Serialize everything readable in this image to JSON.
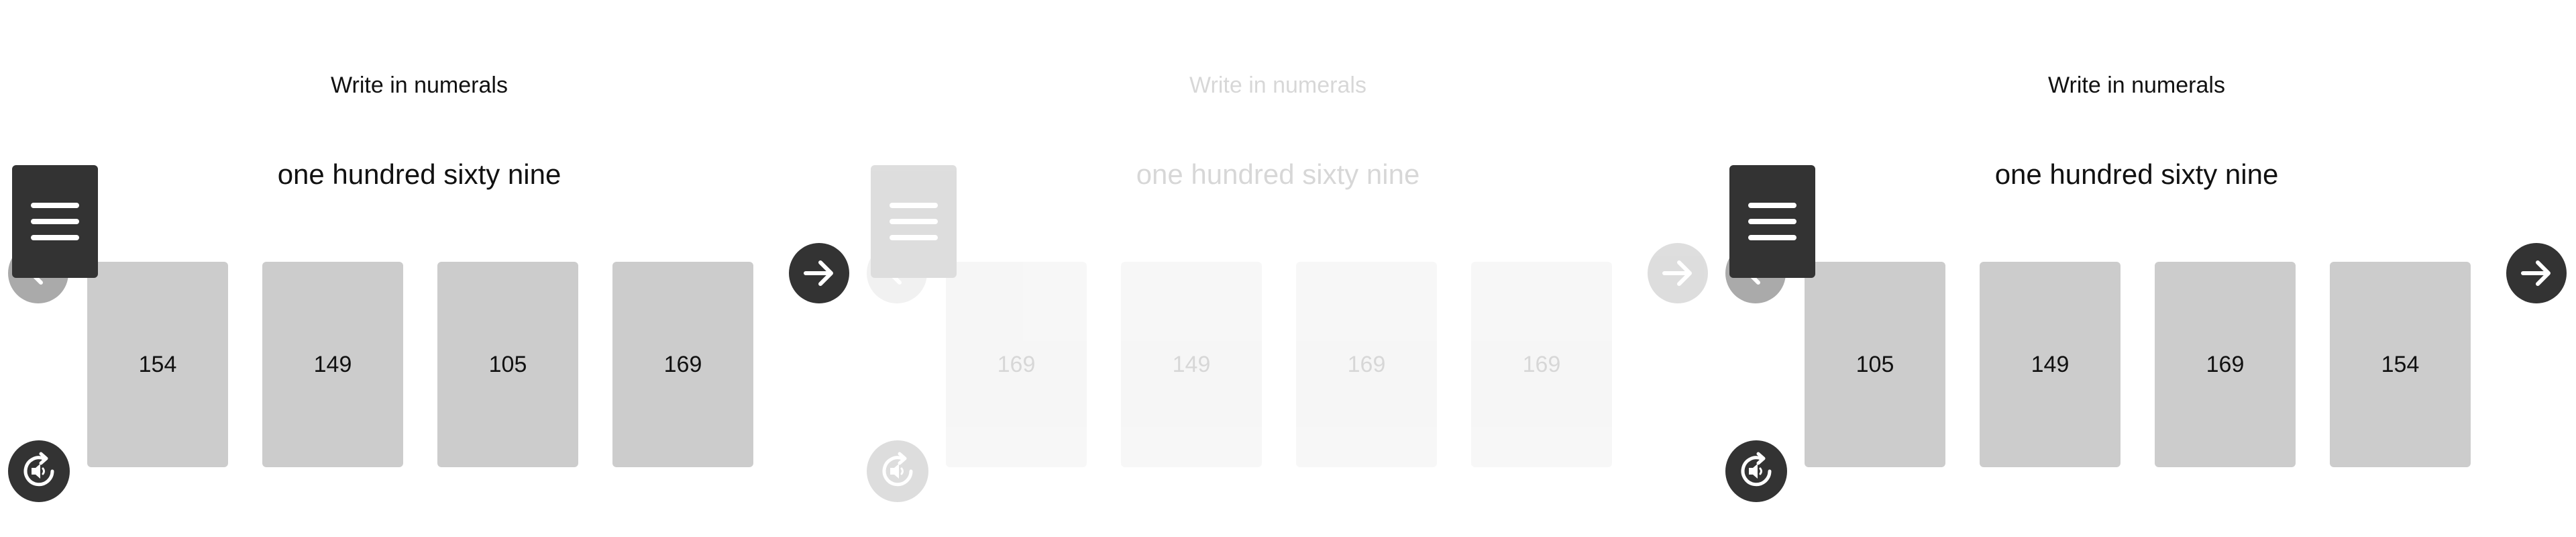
{
  "colors": {
    "background": "#ffffff",
    "card": "#cccccc",
    "dark_button": "#333333",
    "back_button": "#aaaaaa",
    "icon": "#ffffff"
  },
  "icons": {
    "menu": "hamburger-menu-icon",
    "back": "arrow-left-icon",
    "next": "arrow-right-icon",
    "audio": "replay-audio-icon"
  },
  "panels": [
    {
      "state": "active",
      "prompt": "Write in numerals",
      "question": "one hundred sixty nine",
      "options": [
        "154",
        "149",
        "105",
        "169"
      ]
    },
    {
      "state": "faded",
      "prompt": "Write in numerals",
      "question": "one hundred sixty nine",
      "options": [
        "169",
        "149",
        "169",
        "169"
      ]
    },
    {
      "state": "active",
      "prompt": "Write in numerals",
      "question": "one hundred sixty nine",
      "options": [
        "105",
        "149",
        "169",
        "154"
      ]
    }
  ]
}
